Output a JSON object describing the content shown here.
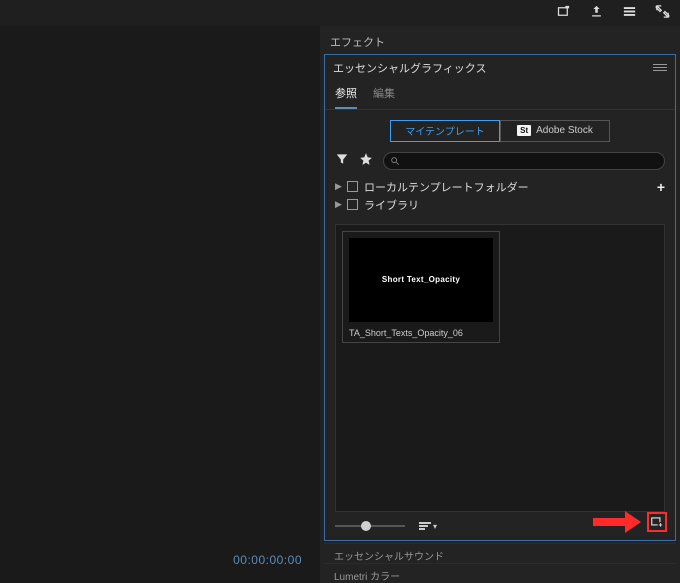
{
  "topbar": {
    "icons": [
      "capture-icon",
      "export-icon",
      "queue-icon",
      "fullscreen-icon"
    ]
  },
  "left": {
    "timecode": "00:00:00:00"
  },
  "effects": {
    "title": "エフェクト"
  },
  "eg": {
    "title": "エッセンシャルグラフィックス",
    "tabs": {
      "browse": "参照",
      "edit": "編集"
    },
    "toggles": {
      "my_templates": "マイテンプレート",
      "adobe_stock": "Adobe Stock",
      "stock_badge": "St"
    },
    "tree": {
      "local": "ローカルテンプレートフォルダー",
      "library": "ライブラリ"
    },
    "template": {
      "thumb_text": "Short Text_Opacity",
      "name": "TA_Short_Texts_Opacity_06"
    }
  },
  "sub": {
    "sound": "エッセンシャルサウンド",
    "lumetri": "Lumetri カラー"
  }
}
